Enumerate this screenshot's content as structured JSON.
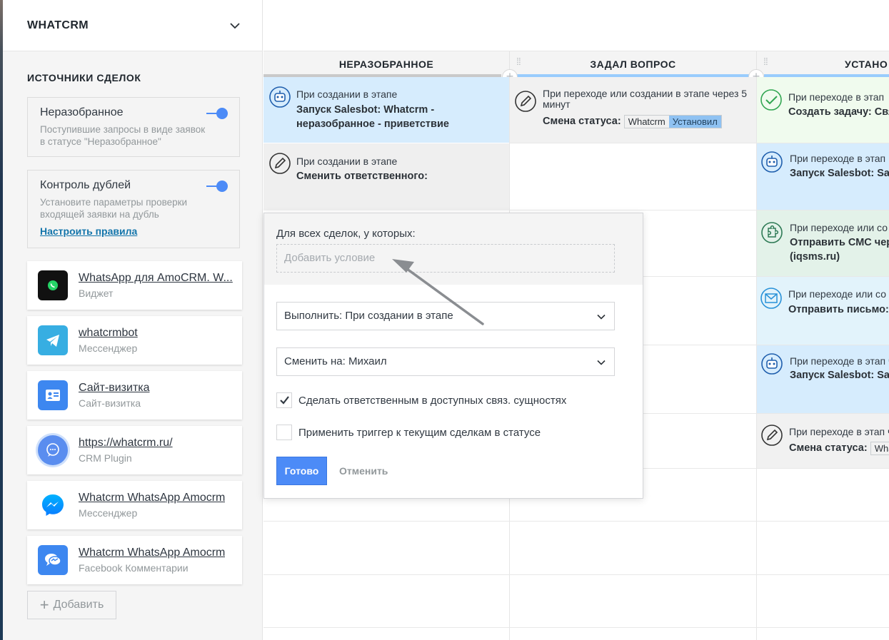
{
  "sidebar": {
    "title": "WHATCRM",
    "section_title": "ИСТОЧНИКИ СДЕЛОК",
    "settings": [
      {
        "name": "Неразобранное",
        "desc": "Поступившие запросы в виде заявок в статусе \"Неразобранное\"",
        "enabled": true
      },
      {
        "name": "Контроль дублей",
        "desc": "Установите параметры проверки входящей заявки на дубль",
        "link": "Настроить правила",
        "enabled": true
      }
    ],
    "sources": [
      {
        "name": "WhatsApp для AmoCRM. W...",
        "type": "Виджет",
        "icon": "whatsapp-icon"
      },
      {
        "name": "whatcrmbot",
        "type": "Мессенджер",
        "icon": "telegram-icon"
      },
      {
        "name": "Сайт-визитка",
        "type": "Сайт-визитка",
        "icon": "contact-card-icon"
      },
      {
        "name": "https://whatcrm.ru/",
        "type": "CRM Plugin",
        "icon": "chat-bubble-icon"
      },
      {
        "name": "Whatcrm WhatsApp Amocrm",
        "type": "Мессенджер",
        "icon": "messenger-icon"
      },
      {
        "name": "Whatcrm WhatsApp Amocrm",
        "type": "Facebook Комментарии",
        "icon": "comments-icon"
      }
    ],
    "add_label": "Добавить"
  },
  "columns": [
    {
      "title": "НЕРАЗОБРАННОЕ",
      "color": "#99ccfd"
    },
    {
      "title": "ЗАДАЛ ВОПРОС",
      "color": "#99ccfd"
    },
    {
      "title": "УСТАНО",
      "color": "#99ccfd"
    }
  ],
  "triggers": {
    "col1": [
      {
        "when": "При создании в этапе",
        "action": "Запуск Salesbot: Whatcrm - неразобранное - приветствие",
        "icon": "robot-icon"
      },
      {
        "when": "При создании в этапе",
        "action": "Сменить ответственного:",
        "icon": "edit-icon"
      }
    ],
    "col2": [
      {
        "when": "При переходе или создании в этапе через 5 минут",
        "action": "Смена статуса:",
        "tag1": "Whatcrm",
        "tag2": "Установил",
        "icon": "edit-icon"
      }
    ],
    "col3": [
      {
        "when": "При переходе в этап",
        "action": "Создать задачу: Свя",
        "icon": "task-check-icon"
      },
      {
        "when": "При переходе в этап",
        "action": "Запуск Salesbot: Sal",
        "icon": "robot-icon"
      },
      {
        "when": "При переходе или со",
        "action": "Отправить СМС чере (iqsms.ru)",
        "icon": "puzzle-icon"
      },
      {
        "when": "При переходе или со",
        "action": "Отправить письмо: У",
        "icon": "email-icon"
      },
      {
        "when": "При переходе в этап ч",
        "action": "Запуск Salesbot: Sal",
        "icon": "robot-icon"
      },
      {
        "when": "При переходе в этап ч",
        "action": "Смена статуса:",
        "tag1": "What",
        "icon": "edit-icon"
      }
    ]
  },
  "popup": {
    "condition_label": "Для всех сделок, у которых:",
    "condition_placeholder": "Добавить условие",
    "execute_select": "Выполнить: При создании в этапе",
    "change_select": "Сменить на: Михаил",
    "check1": {
      "label": "Сделать ответственным в доступных связ. сущностях",
      "checked": true
    },
    "check2": {
      "label": "Применить триггер к текущим сделкам в статусе",
      "checked": false
    },
    "done_label": "Готово",
    "cancel_label": "Отменить"
  },
  "colors": {
    "accent": "#4c8bf7",
    "link": "#1375ab"
  }
}
